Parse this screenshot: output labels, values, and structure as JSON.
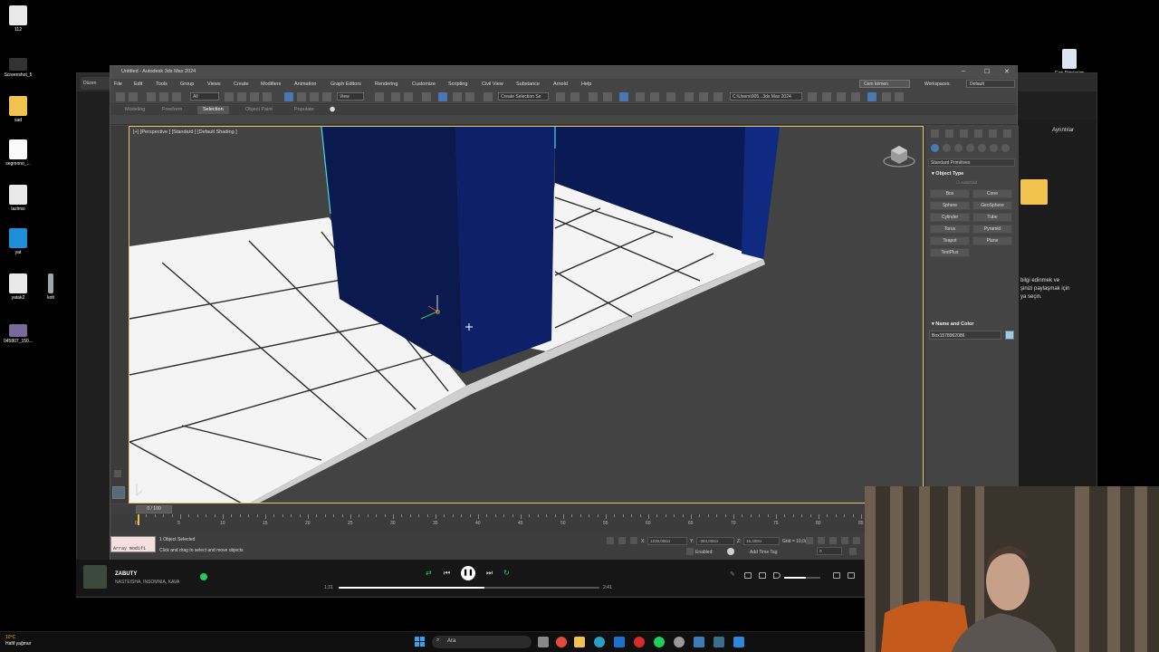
{
  "desktop": {
    "icons": [
      {
        "label": "112",
        "icon": "3dsmax-icon"
      },
      {
        "label": "Screenshot_5",
        "icon": "image-icon"
      },
      {
        "label": "sad",
        "icon": "folder-icon"
      },
      {
        "label": "segmono_...",
        "icon": "file-icon"
      },
      {
        "label": "lazimsi",
        "icon": "3dsmax-icon"
      },
      {
        "label": "yat",
        "icon": "shield-icon"
      },
      {
        "label": "yatak2",
        "icon": "3dsmax-icon"
      },
      {
        "label": "kolt",
        "icon": "figure-icon"
      },
      {
        "label": "045807_150...",
        "icon": "image-icon"
      },
      {
        "label": "Geri Dönüşüm",
        "icon": "recycle-bin-icon"
      }
    ]
  },
  "background_window": {
    "tab": "Düzen",
    "right_panel_button": "Ayrıntılar",
    "right_panel_text": "bilgi edinmek ve\nşinizi paylaşmak için\nya seçin."
  },
  "max": {
    "title": "Untitled - Autodesk 3ds Max 2024",
    "menus": [
      "File",
      "Edit",
      "Tools",
      "Group",
      "Views",
      "Create",
      "Modifiers",
      "Animation",
      "Graph Editors",
      "Rendering",
      "Customize",
      "Scripting",
      "Civil View",
      "Substance",
      "Arnold",
      "Help"
    ],
    "sign_in": "Cem kirmen",
    "workspace_label": "Workspaces:",
    "workspace_value": "Default",
    "selection_filter": "All",
    "ref_coord": "View",
    "selection_set": "Create Selection Se",
    "project_path": "C:\\Users\\905...3ds Max 2024",
    "ribbon_tabs": [
      "Modeling",
      "Freeform",
      "Selection",
      "Object Paint",
      "Populate"
    ],
    "active_ribbon_tab": "Selection",
    "viewport_label": "[+] [Perspective ] [Standard ] [Default Shading ]",
    "command_panel": {
      "category": "Standard Primitives",
      "object_type_header": "Object Type",
      "autogrid": "AutoGrid",
      "primitives": [
        "Box",
        "Cone",
        "Sphere",
        "GeoSphere",
        "Cylinder",
        "Tube",
        "Torus",
        "Pyramid",
        "Teapot",
        "Plane",
        "TextPlus"
      ],
      "name_color_header": "Name and Color",
      "object_name": "Box1578962086",
      "object_color": "#9ccbe6"
    },
    "timeline": {
      "frame_display": "0 / 100",
      "current_frame": 0,
      "ticks": [
        0,
        5,
        10,
        15,
        20,
        25,
        30,
        35,
        40,
        45,
        50,
        55,
        60,
        65,
        70,
        75,
        80,
        85
      ]
    },
    "status": {
      "maxscript": "Array modifi",
      "selected": "1 Object Selected",
      "prompt": "Click and drag to select and move objects",
      "x_label": "X:",
      "x": "1239,006cr",
      "y_label": "Y:",
      "y": "-384,006cr",
      "z_label": "Z:",
      "z": "16,409cr",
      "grid": "Grid = 10,0cm",
      "enabled": "Enabled:",
      "add_time_tag": "Add Time Tag",
      "frame_field": "0"
    }
  },
  "player": {
    "title": "ZABUTY",
    "artist": "NASTEISHA, INSOMNIA, KAVA",
    "elapsed": "1:31",
    "total": "2:41",
    "progress": 0.56,
    "volume": 0.6
  },
  "taskbar": {
    "temperature": "10°C",
    "weather": "Hafif yağmur",
    "search": "Ara"
  },
  "colors": {
    "accent": "#4a78b0",
    "viewport_border": "#e6c36a",
    "object_blue": "#0a1f5c",
    "floor_tile": "#f4f4f4",
    "spotify_green": "#1fcf5d"
  }
}
